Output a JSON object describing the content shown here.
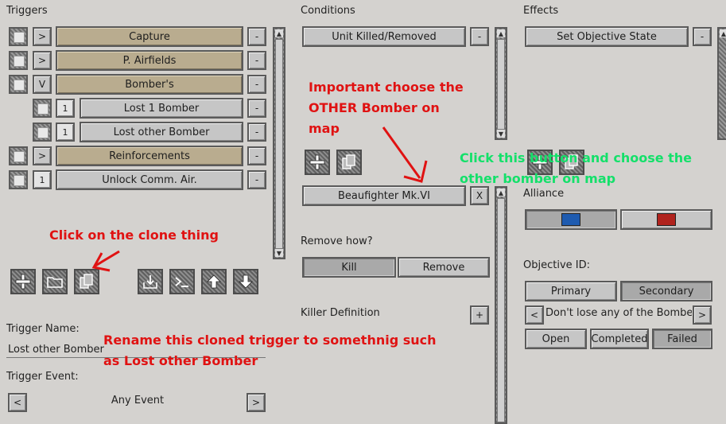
{
  "panels": {
    "triggers": "Triggers",
    "conditions": "Conditions",
    "effects": "Effects"
  },
  "triggers": [
    {
      "toggle": ">",
      "label": "Capture",
      "minus": "-"
    },
    {
      "toggle": ">",
      "label": "P. Airfields",
      "minus": "-"
    },
    {
      "toggle": "V",
      "label": "Bomber's",
      "minus": "-"
    },
    {
      "toggle": "1",
      "label": "Lost 1 Bomber",
      "minus": "-"
    },
    {
      "toggle": "1",
      "label": "Lost other Bomber",
      "minus": "-"
    },
    {
      "toggle": ">",
      "label": "Reinforcements",
      "minus": "-"
    },
    {
      "toggle": "1",
      "label": "Unlock Comm. Air.",
      "minus": "-"
    }
  ],
  "conditions": {
    "items": [
      {
        "label": "Unit Killed/Removed",
        "minus": "-"
      }
    ],
    "unit": {
      "label": "Beaufighter Mk.VI",
      "close": "X"
    },
    "remove_how_label": "Remove how?",
    "kill": "Kill",
    "remove": "Remove",
    "killer_definition": "Killer Definition",
    "killer_add": "+"
  },
  "effects": {
    "items": [
      {
        "label": "Set Objective State",
        "minus": "-"
      }
    ],
    "alliance_label": "Alliance",
    "alliance_colors": {
      "blue": "#1e5bb0",
      "red": "#b0231e"
    },
    "objective_id_label": "Objective ID:",
    "primary": "Primary",
    "secondary": "Secondary",
    "prev": "<",
    "objective_text": "Don't lose any of the Bomber's",
    "next": ">",
    "open": "Open",
    "completed": "Completed",
    "failed": "Failed"
  },
  "trigger_name_label": "Trigger Name:",
  "trigger_name_value": "Lost other Bomber",
  "trigger_event_label": "Trigger Event:",
  "trigger_event_prev": "<",
  "trigger_event_value": "Any Event",
  "trigger_event_next": ">",
  "annotations": {
    "important": [
      "Important choose the",
      "OTHER Bomber on",
      "map"
    ],
    "click_button": [
      "Click this button and choose the",
      "other bomber on map"
    ],
    "clone": "Click on the clone thing",
    "rename": [
      "Rename this cloned trigger to somethnig such",
      "as Lost other Bomber"
    ]
  },
  "icon_names": [
    "plus-icon",
    "folder-icon",
    "clone-icon",
    "import-icon",
    "console-icon",
    "arrow-up-icon",
    "arrow-down-icon"
  ]
}
